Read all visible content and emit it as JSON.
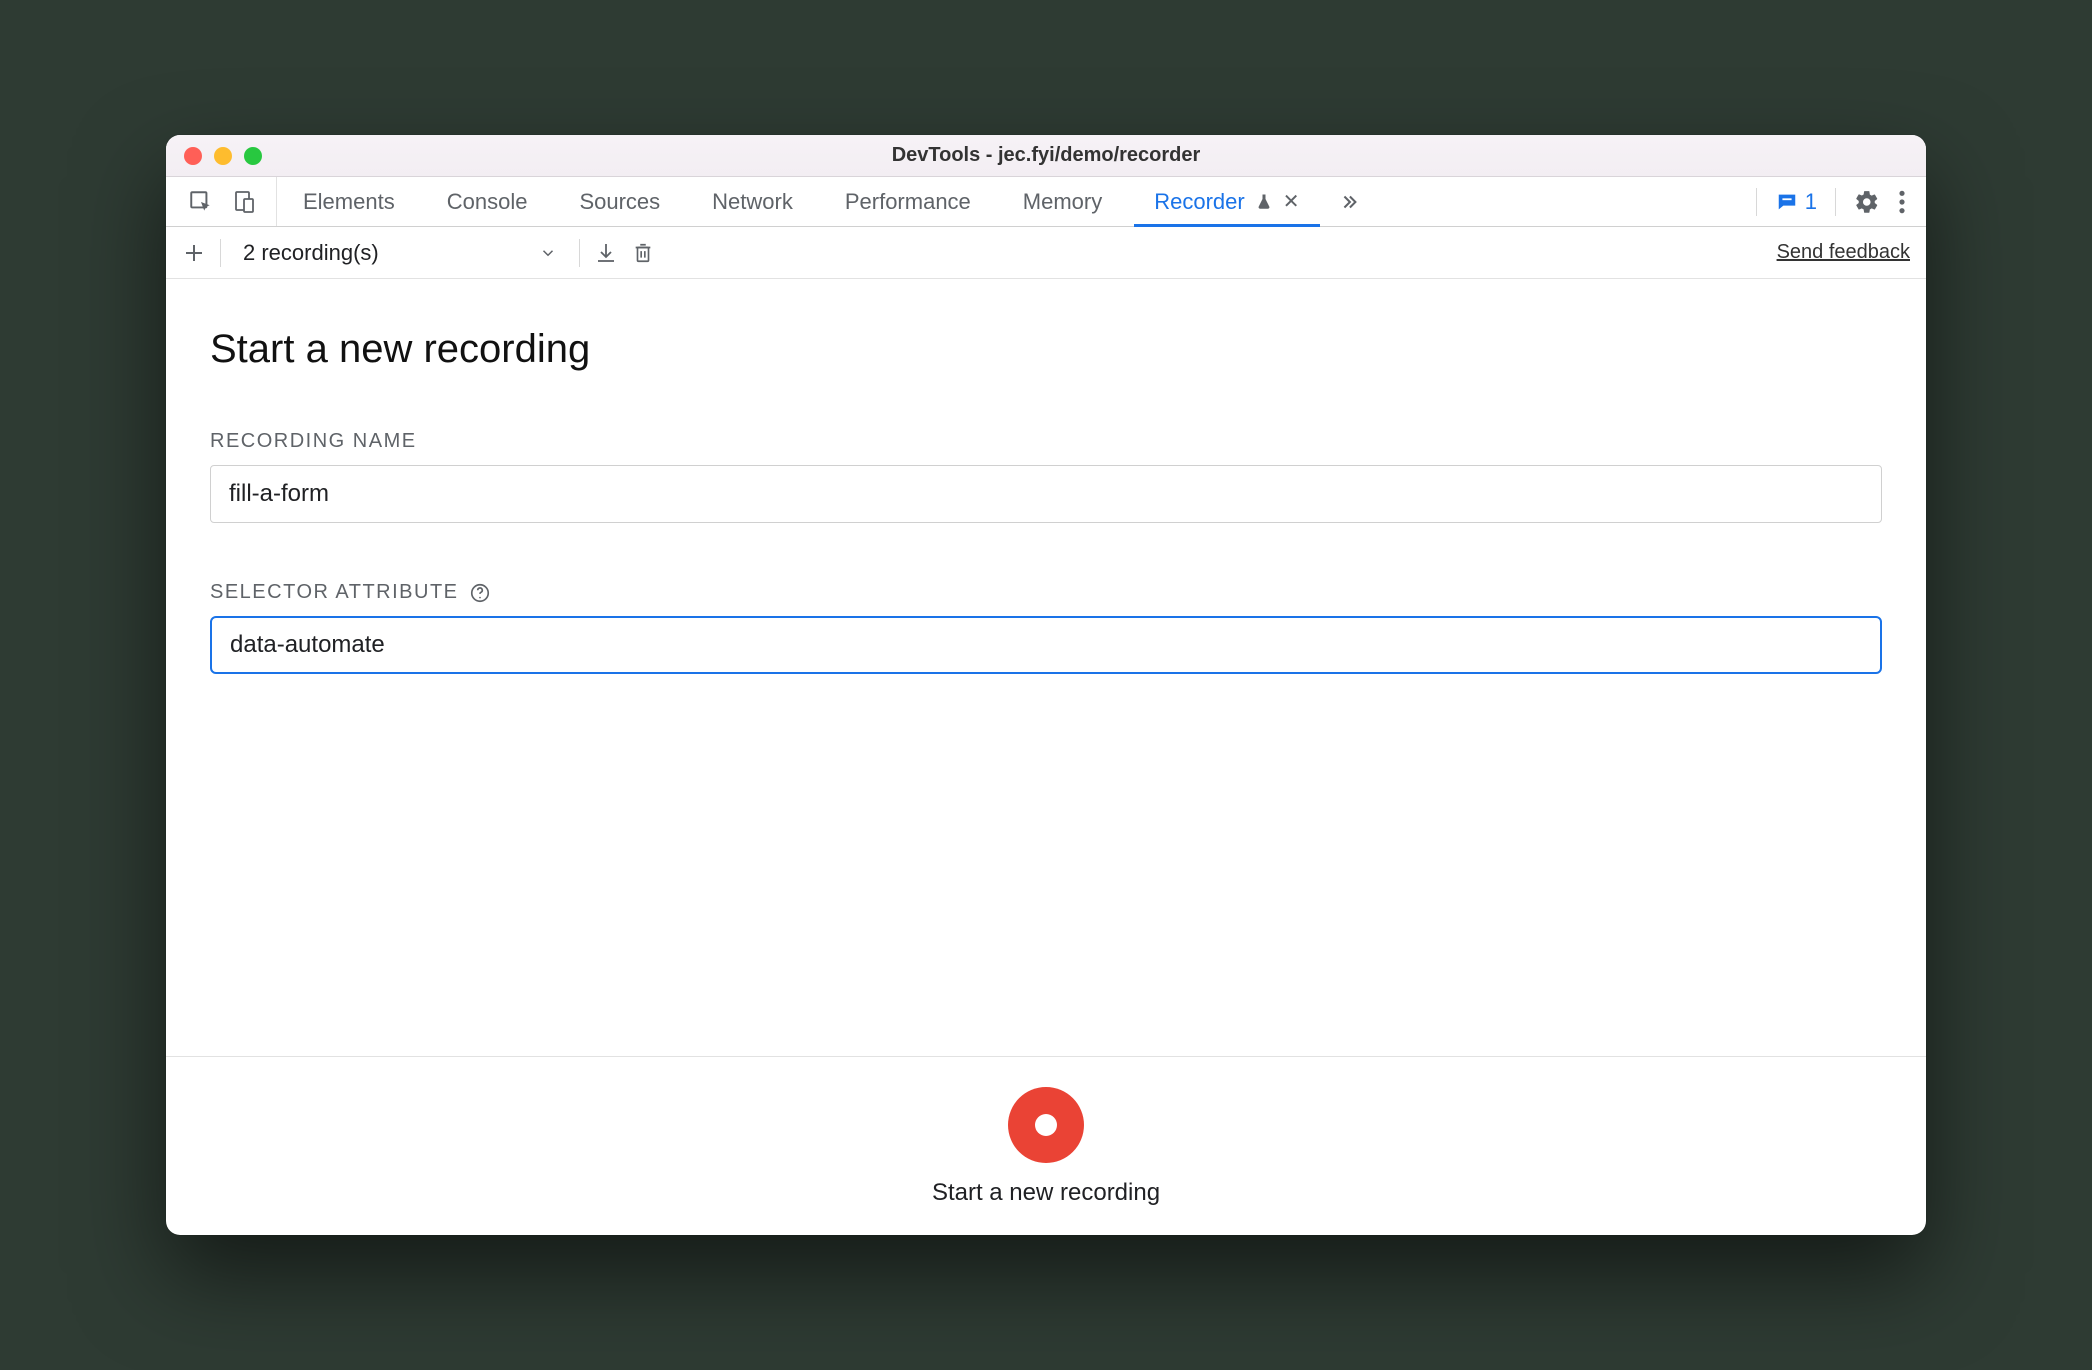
{
  "window": {
    "title": "DevTools - jec.fyi/demo/recorder"
  },
  "tabs": {
    "items": [
      {
        "label": "Elements"
      },
      {
        "label": "Console"
      },
      {
        "label": "Sources"
      },
      {
        "label": "Network"
      },
      {
        "label": "Performance"
      },
      {
        "label": "Memory"
      },
      {
        "label": "Recorder",
        "active": true
      }
    ],
    "issues_count": "1"
  },
  "toolbar": {
    "dropdown_label": "2 recording(s)",
    "send_feedback": "Send feedback"
  },
  "page": {
    "title": "Start a new recording",
    "fields": {
      "recording_name": {
        "label": "RECORDING NAME",
        "value": "fill-a-form"
      },
      "selector_attribute": {
        "label": "SELECTOR ATTRIBUTE",
        "value": "data-automate"
      }
    }
  },
  "footer": {
    "label": "Start a new recording"
  }
}
